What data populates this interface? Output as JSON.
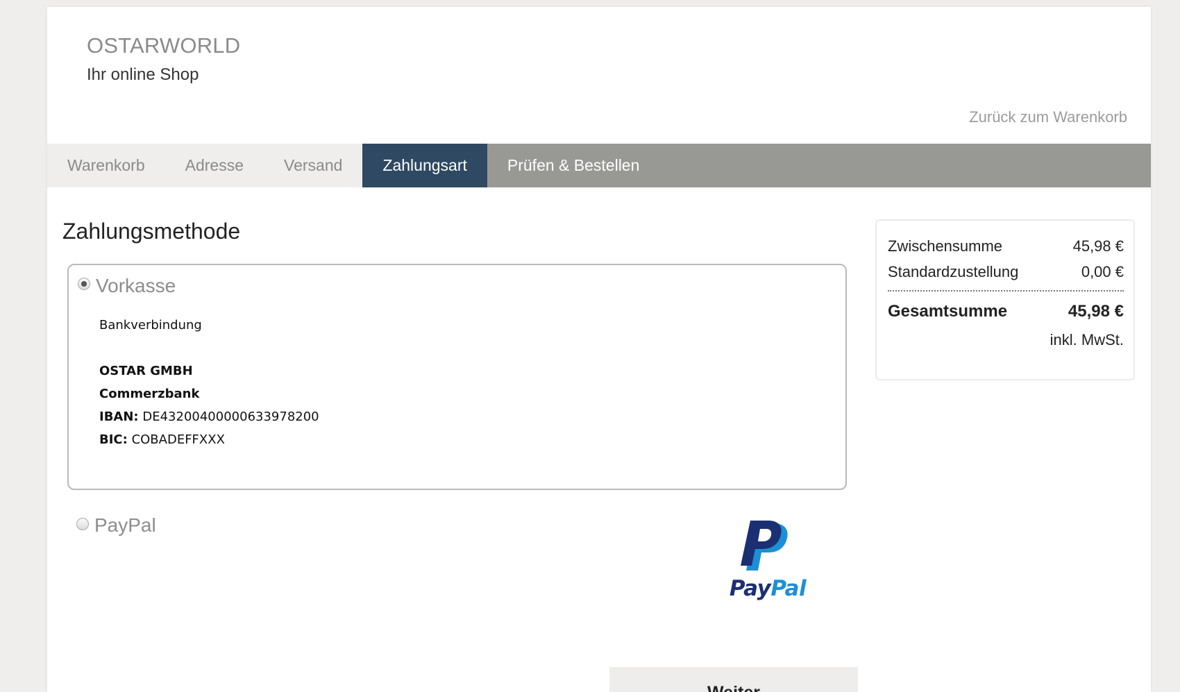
{
  "header": {
    "brand_name": "OSTARWORLD",
    "tagline": "Ihr online Shop",
    "back_link": "Zurück zum Warenkorb"
  },
  "steps": [
    {
      "label": "Warenkorb",
      "state": "done"
    },
    {
      "label": "Adresse",
      "state": "done"
    },
    {
      "label": "Versand",
      "state": "done"
    },
    {
      "label": "Zahlungsart",
      "state": "active"
    },
    {
      "label": "Prüfen & Bestellen",
      "state": "todo"
    }
  ],
  "payment": {
    "title": "Zahlungsmethode",
    "options": [
      {
        "label": "Vorkasse",
        "selected": true,
        "details": {
          "heading": "Bankverbindung",
          "company": "OSTAR GMBH",
          "bank": "Commerzbank",
          "iban_label": "IBAN:",
          "iban": "DE43200400000633978200",
          "bic_label": "BIC:",
          "bic": "COBADEFFXXX"
        }
      },
      {
        "label": "PayPal",
        "selected": false,
        "logo_text_1": "Pay",
        "logo_text_2": "Pal"
      }
    ],
    "submit_label": "Weiter"
  },
  "summary": {
    "subtotal_label": "Zwischensumme",
    "subtotal_value": "45,98 €",
    "shipping_label": "Standardzustellung",
    "shipping_value": "0,00 €",
    "total_label": "Gesamtsumme",
    "total_value": "45,98 €",
    "tax_note": "inkl. MwSt."
  },
  "colors": {
    "active_step": "#2f4963",
    "step_bar": "#989894",
    "paypal_dark": "#1b2f73",
    "paypal_light": "#1c8fd6"
  }
}
